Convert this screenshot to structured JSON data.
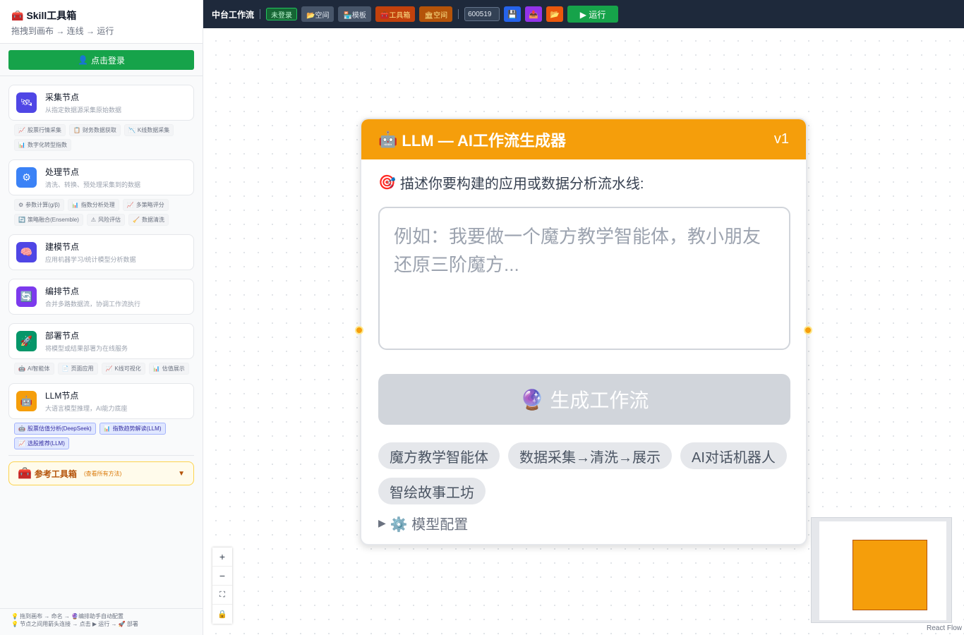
{
  "sidebar": {
    "title": "Skill工具箱",
    "subtitle": "拖拽到画布 → 连线 → 运行",
    "login_label": "点击登录",
    "categories": [
      {
        "name": "采集节点",
        "desc": "从指定数据源采集原始数据",
        "icon": "🛰",
        "color": "#4f46e5",
        "chips": [
          {
            "icon": "📈",
            "label": "股票行情采集"
          },
          {
            "icon": "📋",
            "label": "财务数据获取"
          },
          {
            "icon": "📉",
            "label": "K线数据采集"
          },
          {
            "icon": "📊",
            "label": "数字化转型指数"
          }
        ]
      },
      {
        "name": "处理节点",
        "desc": "清洗、转换、预处理采集到的数据",
        "icon": "⚙",
        "color": "#3b82f6",
        "chips": [
          {
            "icon": "⚙",
            "label": "参数计算(g/β)"
          },
          {
            "icon": "📊",
            "label": "指数分析处理"
          },
          {
            "icon": "📈",
            "label": "多策略评分"
          },
          {
            "icon": "🔄",
            "label": "策略融合(Ensemble)"
          },
          {
            "icon": "⚠",
            "label": "风险评估"
          },
          {
            "icon": "🧹",
            "label": "数据清洗"
          }
        ]
      },
      {
        "name": "建模节点",
        "desc": "应用机器学习/统计模型分析数据",
        "icon": "🧠",
        "color": "#4f46e5",
        "chips": []
      },
      {
        "name": "编排节点",
        "desc": "合并多路数据流，协调工作流执行",
        "icon": "🔄",
        "color": "#7c3aed",
        "chips": []
      },
      {
        "name": "部署节点",
        "desc": "将模型或结果部署为在线服务",
        "icon": "🚀",
        "color": "#059669",
        "chips": [
          {
            "icon": "🤖",
            "label": "AI智能体"
          },
          {
            "icon": "📄",
            "label": "页面应用"
          },
          {
            "icon": "📈",
            "label": "K线可视化"
          },
          {
            "icon": "📊",
            "label": "估值展示"
          }
        ]
      },
      {
        "name": "LLM节点",
        "desc": "大语言模型推理，AI能力底座",
        "icon": "🤖",
        "color": "#f59e0b",
        "chips": [
          {
            "icon": "🤖",
            "label": "股票估值分析(DeepSeek)"
          },
          {
            "icon": "📊",
            "label": "指数趋势解读(LLM)"
          },
          {
            "icon": "📈",
            "label": "选股推荐(LLM)"
          }
        ]
      }
    ],
    "reference": {
      "title": "参考工具箱",
      "sub": "(查看所有方法)"
    },
    "footer_line1": "💡 拖到画布 → 命名 → 🔮编排助手自动配置",
    "footer_line2": "💡 节点之间用箭头连接 → 点击 ▶ 运行 → 🚀 部署"
  },
  "toolbar": {
    "title": "中台工作流",
    "status": "未登录",
    "space_label": "📂空间",
    "template_label": "🏪模板",
    "toolbox_label": "🧰工具箱",
    "space2_label": "🏛空间",
    "stock_code": "600519",
    "save_icon": "💾",
    "inbox_icon": "📤",
    "folder_icon": "📂",
    "run_label": "▶ 运行"
  },
  "node": {
    "icon": "🤖",
    "title": "LLM — AI工作流生成器",
    "version": "v1",
    "label_icon": "🎯",
    "label": "描述你要构建的应用或数据分析流水线:",
    "placeholder": "例如：我要做一个魔方教学智能体，教小朋友还原三阶魔方...",
    "generate_icon": "🔮",
    "generate_label": "生成工作流",
    "templates": [
      "魔方教学智能体",
      "数据采集→清洗→展示",
      "AI对话机器人",
      "智绘故事工坊"
    ],
    "model_config_label": "⚙️ 模型配置"
  },
  "flow": {
    "attribution": "React Flow"
  },
  "colors": {
    "topbar": "#1e293b",
    "node_header": "#f59e0b",
    "login": "#16a34a"
  }
}
